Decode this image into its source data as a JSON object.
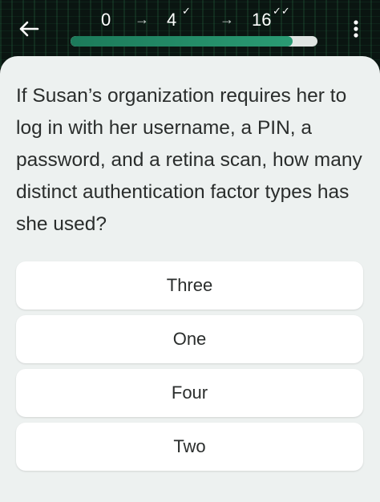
{
  "header": {
    "back_icon": "arrow-left-icon",
    "menu_icon": "vertical-dots-icon",
    "steps": [
      {
        "value": "0",
        "check": ""
      },
      {
        "value": "4",
        "check": "✓"
      },
      {
        "value": "16",
        "check": "✓✓"
      }
    ],
    "arrow_glyph": "→",
    "progress_fraction": 0.9
  },
  "question": {
    "text": "If Susan’s organization requires her to log in with her username, a PIN, a password, and a retina scan, how many distinct authentication factor types has she used?"
  },
  "options": [
    {
      "label": "Three"
    },
    {
      "label": "One"
    },
    {
      "label": "Four"
    },
    {
      "label": "Two"
    }
  ],
  "colors": {
    "accent": "#1c7a5a",
    "background": "#edf1f0"
  }
}
